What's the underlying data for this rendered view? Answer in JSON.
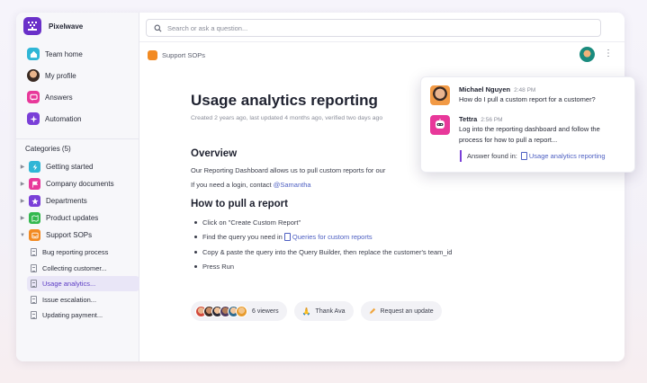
{
  "brand": {
    "name": "Pixelwave"
  },
  "nav": [
    {
      "label": "Team home",
      "icon": "home-icon",
      "color": "#2fb6d6"
    },
    {
      "label": "My profile",
      "icon": "avatar-icon",
      "color": "#d98a4b"
    },
    {
      "label": "Answers",
      "icon": "chat-icon",
      "color": "#e8389a"
    },
    {
      "label": "Automation",
      "icon": "sparkle-icon",
      "color": "#7a3fd8"
    }
  ],
  "categories": {
    "title": "Categories (5)",
    "items": [
      {
        "label": "Getting started",
        "icon": "bolt-icon",
        "color": "#2fb6d6"
      },
      {
        "label": "Company documents",
        "icon": "flag-icon",
        "color": "#e8389a"
      },
      {
        "label": "Departments",
        "icon": "star-icon",
        "color": "#7a3fd8"
      },
      {
        "label": "Product updates",
        "icon": "map-icon",
        "color": "#34b84f"
      },
      {
        "label": "Support SOPs",
        "icon": "tray-icon",
        "color": "#f28a22"
      }
    ],
    "sub_items": [
      {
        "label": "Bug reporting process"
      },
      {
        "label": "Collecting customer..."
      },
      {
        "label": "Usage analytics..."
      },
      {
        "label": "Issue escalation..."
      },
      {
        "label": "Updating payment..."
      }
    ]
  },
  "search": {
    "placeholder": "Search or ask a question..."
  },
  "breadcrumb": "Support SOPs",
  "doc": {
    "title": "Usage analytics reporting",
    "meta": "Created 2 years ago, last updated 4 months ago, verified two days ago",
    "overview_heading": "Overview",
    "overview_text": "Our Reporting Dashboard allows us to pull custom reports for our",
    "login_text": "If you need a login, contact ",
    "login_link": "@Samantha",
    "howto_heading": "How to pull a report",
    "steps": {
      "step1": "Click on \"Create Custom Report\"",
      "step2_text": "Find the query you need in ",
      "step2_link": "Queries for custom reports",
      "step3": "Copy & paste the query into the Query Builder, then replace the customer's team_id",
      "step4": "Press Run"
    }
  },
  "footer": {
    "viewers": "6 viewers",
    "thank": "Thank Ava",
    "request": "Request an update"
  },
  "chat": {
    "msg1": {
      "name": "Michael Nguyen",
      "time": "2:48 PM",
      "text": "How do I pull a custom report for a customer?"
    },
    "msg2": {
      "name": "Tettra",
      "time": "2:56 PM",
      "text": "Log into the reporting dashboard and follow the process for how to pull a report..."
    },
    "found_label": "Answer found in:",
    "found_link": "Usage analytics reporting"
  }
}
